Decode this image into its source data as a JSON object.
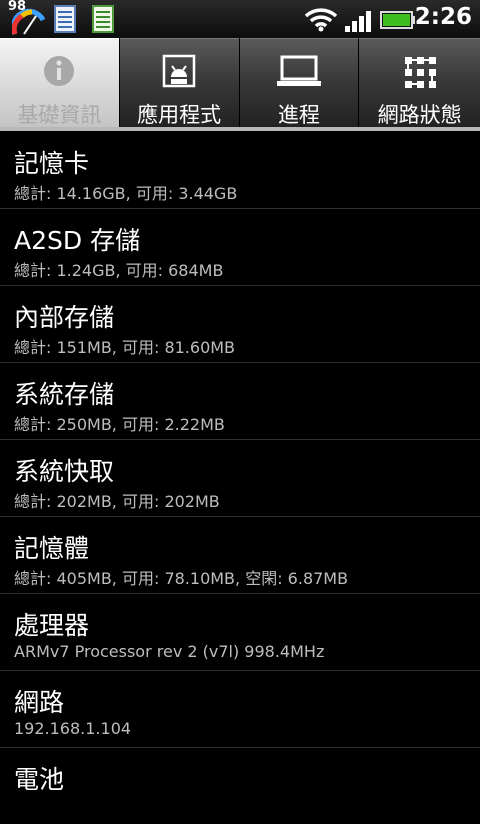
{
  "status_bar": {
    "battery_level_text": "98",
    "time": "2:26",
    "icons": [
      "speedometer-icon",
      "document-icon",
      "document-list-icon",
      "wifi-icon",
      "signal-icon",
      "battery-icon"
    ]
  },
  "tabs": [
    {
      "label": "基礎資訊",
      "icon": "info-icon",
      "selected": true
    },
    {
      "label": "應用程式",
      "icon": "android-app-icon",
      "selected": false
    },
    {
      "label": "進程",
      "icon": "laptop-icon",
      "selected": false
    },
    {
      "label": "網路狀態",
      "icon": "network-icon",
      "selected": false
    }
  ],
  "items": [
    {
      "title": "記憶卡",
      "detail": "總計: 14.16GB, 可用: 3.44GB"
    },
    {
      "title": "A2SD 存儲",
      "detail": "總計: 1.24GB, 可用: 684MB"
    },
    {
      "title": "內部存儲",
      "detail": "總計: 151MB, 可用: 81.60MB"
    },
    {
      "title": "系統存儲",
      "detail": "總計: 250MB, 可用: 2.22MB"
    },
    {
      "title": "系統快取",
      "detail": "總計: 202MB, 可用: 202MB"
    },
    {
      "title": "記憶體",
      "detail": "總計: 405MB, 可用: 78.10MB, 空閑: 6.87MB"
    },
    {
      "title": "處理器",
      "detail": "ARMv7 Processor rev 2 (v7l)  998.4MHz"
    },
    {
      "title": "網路",
      "detail": "192.168.1.104"
    },
    {
      "title": "電池",
      "detail": ""
    }
  ],
  "colors": {
    "background": "#000000",
    "accent_battery": "#3fbf1f",
    "text_secondary": "#bdbdbd"
  }
}
